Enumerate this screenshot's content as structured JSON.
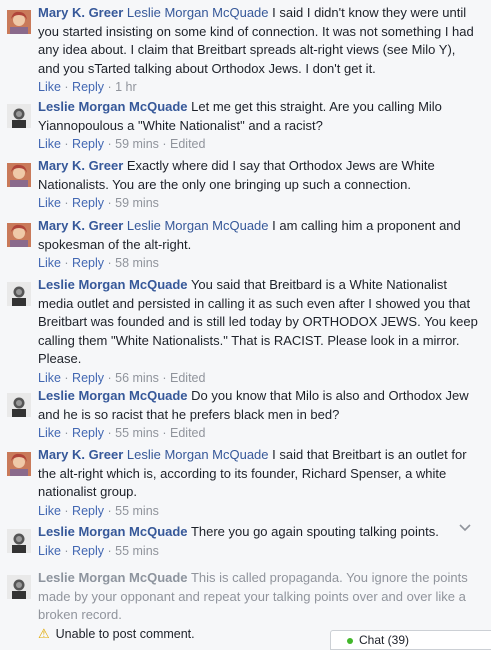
{
  "colors": {
    "link_blue": "#365899",
    "action_blue": "#4267b2",
    "meta_gray": "#90949c",
    "warning_yellow": "#e0a800",
    "online_green": "#42b72a"
  },
  "comments": [
    {
      "author": "Mary K. Greer",
      "avatar": "mary-avatar",
      "mention": "Leslie Morgan McQuade",
      "text": "I said I didn't know they were until you started insisting on some kind of connection. It was not something I had any idea about. I claim that Breitbart spreads alt-right views (see Milo Y), and you sTarted talking about Orthodox Jews. I don't get it.",
      "like": "Like",
      "reply": "Reply",
      "time": "1 hr",
      "edited": ""
    },
    {
      "author": "Leslie Morgan McQuade",
      "avatar": "leslie-avatar",
      "mention": "",
      "text": "Let me get this straight. Are you calling Milo Yiannopoulous a \"White Nationalist\" and a racist?",
      "like": "Like",
      "reply": "Reply",
      "time": "59 mins",
      "edited": "Edited"
    },
    {
      "author": "Mary K. Greer",
      "avatar": "mary-avatar",
      "mention": "",
      "text": "Exactly where did I say that Orthodox Jews are White Nationalists. You are the only one bringing up such a connection.",
      "like": "Like",
      "reply": "Reply",
      "time": "59 mins",
      "edited": ""
    },
    {
      "author": "Mary K. Greer",
      "avatar": "mary-avatar",
      "mention": "Leslie Morgan McQuade",
      "text": "I am calling him a proponent and spokesman of the alt-right.",
      "like": "Like",
      "reply": "Reply",
      "time": "58 mins",
      "edited": ""
    },
    {
      "author": "Leslie Morgan McQuade",
      "avatar": "leslie-avatar",
      "mention": "",
      "text": "You said that Breitbard is a White Nationalist media outlet and persisted in calling it as such even after I showed you that Breitbart was founded and is still led today by ORTHODOX JEWS. You keep calling them \"White Nationalists.\" That is RACIST. Please look in a mirror. Please.",
      "like": "Like",
      "reply": "Reply",
      "time": "56 mins",
      "edited": "Edited"
    },
    {
      "author": "Leslie Morgan McQuade",
      "avatar": "leslie-avatar",
      "mention": "",
      "text": "Do you know that Milo is also and Orthodox Jew and he is so racist that he prefers black men in bed?",
      "like": "Like",
      "reply": "Reply",
      "time": "55 mins",
      "edited": "Edited"
    },
    {
      "author": "Mary K. Greer",
      "avatar": "mary-avatar",
      "mention": "Leslie Morgan McQuade",
      "text": "I said that Breitbart is an outlet for the alt-right which is, according to its founder, Richard Spenser, a white nationalist group.",
      "like": "Like",
      "reply": "Reply",
      "time": "55 mins",
      "edited": ""
    },
    {
      "author": "Leslie Morgan McQuade",
      "avatar": "leslie-avatar",
      "mention": "",
      "text": "There you go again spouting talking points.",
      "like": "Like",
      "reply": "Reply",
      "time": "55 mins",
      "edited": ""
    }
  ],
  "pending": {
    "author": "Leslie Morgan McQuade",
    "avatar": "leslie-avatar",
    "text": "This is called propaganda. You ignore the points made by your opponant and repeat your talking points over and over like a broken record.",
    "error": "Unable to post comment."
  },
  "chat": {
    "label": "Chat (39)"
  }
}
